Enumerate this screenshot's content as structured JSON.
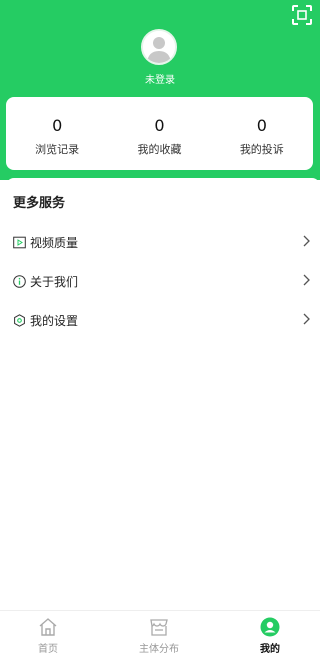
{
  "header": {
    "login_label": "未登录",
    "scan_icon": "scan-icon"
  },
  "stats": [
    {
      "value": "0",
      "label": "浏览记录"
    },
    {
      "value": "0",
      "label": "我的收藏"
    },
    {
      "value": "0",
      "label": "我的投诉"
    }
  ],
  "services": {
    "title": "更多服务",
    "items": [
      {
        "label": "视频质量",
        "icon": "video-icon"
      },
      {
        "label": "关于我们",
        "icon": "info-icon"
      },
      {
        "label": "我的设置",
        "icon": "settings-icon"
      }
    ]
  },
  "tabbar": {
    "tabs": [
      {
        "label": "首页",
        "icon": "home-icon",
        "active": false
      },
      {
        "label": "主体分布",
        "icon": "store-icon",
        "active": false
      },
      {
        "label": "我的",
        "icon": "profile-icon",
        "active": true
      }
    ]
  },
  "colors": {
    "brand": "#25cc63",
    "inactive": "#999999"
  }
}
